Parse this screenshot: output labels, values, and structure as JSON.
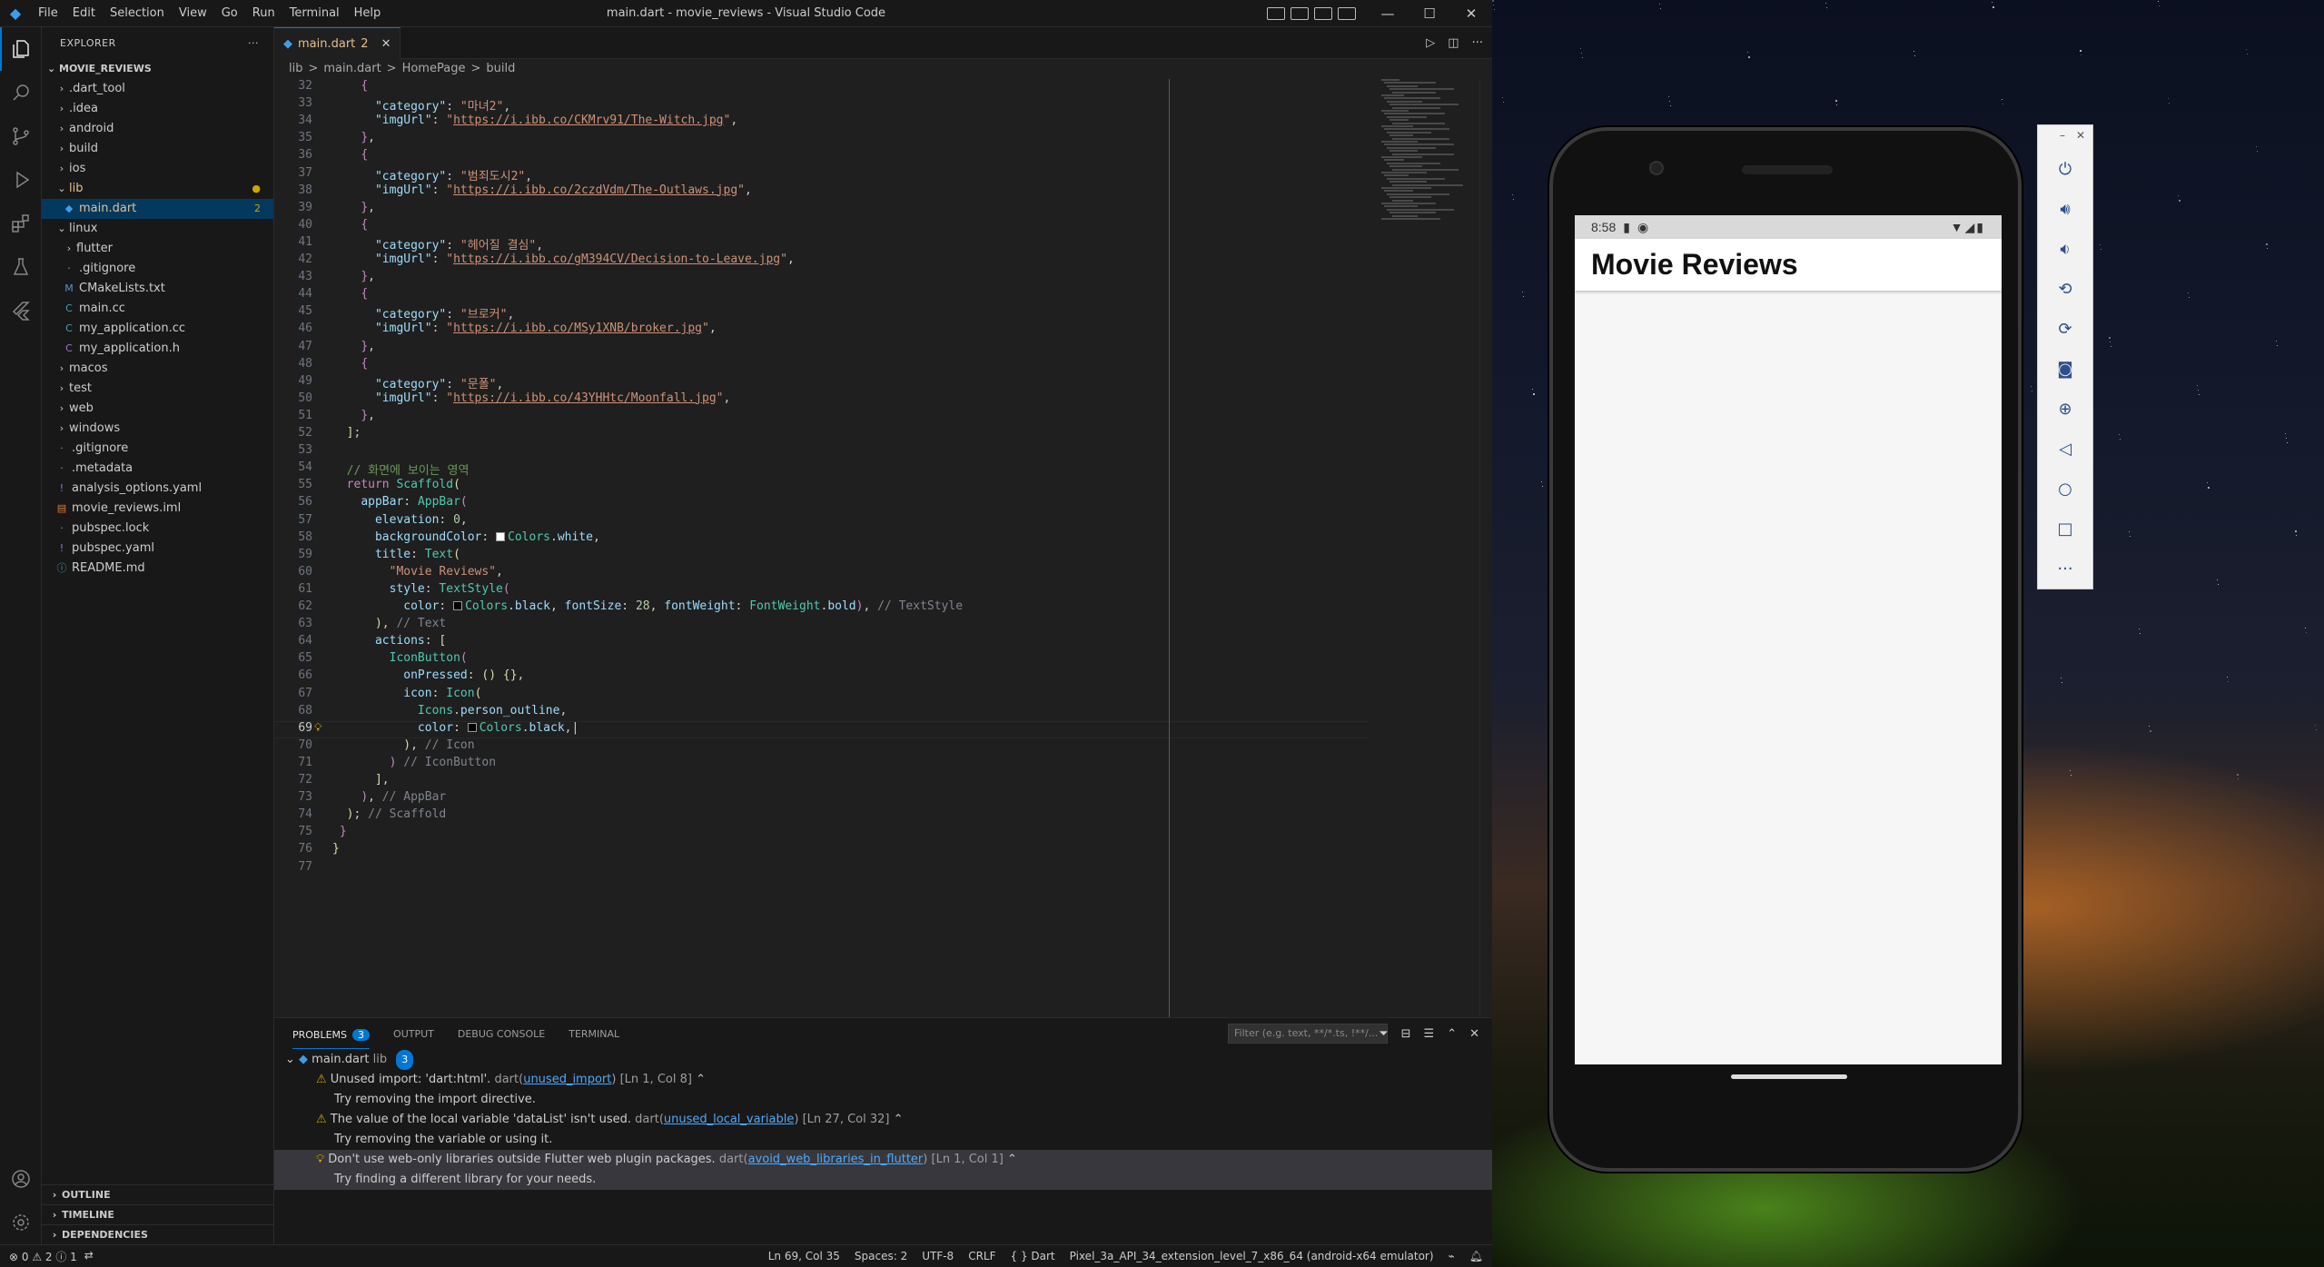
{
  "window": {
    "title": "main.dart - movie_reviews - Visual Studio Code",
    "menu": [
      "File",
      "Edit",
      "Selection",
      "View",
      "Go",
      "Run",
      "Terminal",
      "Help"
    ]
  },
  "explorer": {
    "header": "EXPLORER",
    "root": "MOVIE_REVIEWS",
    "items": [
      {
        "label": ".dart_tool",
        "kind": "folder",
        "depth": 0
      },
      {
        "label": ".idea",
        "kind": "folder",
        "depth": 0
      },
      {
        "label": "android",
        "kind": "folder",
        "depth": 0
      },
      {
        "label": "build",
        "kind": "folder",
        "depth": 0
      },
      {
        "label": "ios",
        "kind": "folder",
        "depth": 0
      },
      {
        "label": "lib",
        "kind": "folder-open",
        "depth": 0,
        "modified": true
      },
      {
        "label": "main.dart",
        "kind": "dart",
        "depth": 1,
        "selected": true,
        "badge": "2"
      },
      {
        "label": "linux",
        "kind": "folder-open",
        "depth": 0
      },
      {
        "label": "flutter",
        "kind": "folder",
        "depth": 1
      },
      {
        "label": ".gitignore",
        "kind": "file",
        "depth": 1
      },
      {
        "label": "CMakeLists.txt",
        "kind": "cmake",
        "depth": 1
      },
      {
        "label": "main.cc",
        "kind": "cpp",
        "depth": 1
      },
      {
        "label": "my_application.cc",
        "kind": "cpp",
        "depth": 1
      },
      {
        "label": "my_application.h",
        "kind": "c",
        "depth": 1
      },
      {
        "label": "macos",
        "kind": "folder",
        "depth": 0
      },
      {
        "label": "test",
        "kind": "folder",
        "depth": 0
      },
      {
        "label": "web",
        "kind": "folder",
        "depth": 0
      },
      {
        "label": "windows",
        "kind": "folder",
        "depth": 0
      },
      {
        "label": ".gitignore",
        "kind": "file",
        "depth": 0
      },
      {
        "label": ".metadata",
        "kind": "file",
        "depth": 0
      },
      {
        "label": "analysis_options.yaml",
        "kind": "yaml",
        "depth": 0
      },
      {
        "label": "movie_reviews.iml",
        "kind": "iml",
        "depth": 0
      },
      {
        "label": "pubspec.lock",
        "kind": "file",
        "depth": 0
      },
      {
        "label": "pubspec.yaml",
        "kind": "yaml",
        "depth": 0
      },
      {
        "label": "README.md",
        "kind": "info",
        "depth": 0
      }
    ],
    "sections": [
      "OUTLINE",
      "TIMELINE",
      "DEPENDENCIES"
    ]
  },
  "editor": {
    "tab": {
      "label": "main.dart",
      "badge": "2"
    },
    "breadcrumb": [
      "lib",
      ">",
      "main.dart",
      ">",
      "HomePage",
      ">",
      "build"
    ],
    "current_line": "69",
    "lines": [
      {
        "n": "32",
        "html": "    <span class='k'>{</span>"
      },
      {
        "n": "33",
        "html": "      <span class='p'>\"category\"</span>: <span class='s'>\"마녀2\"</span>,"
      },
      {
        "n": "34",
        "html": "      <span class='p'>\"imgUrl\"</span>: <span class='s'>\"</span><span class='u'>https://i.ibb.co/CKMrv91/The-Witch.jpg</span><span class='s'>\"</span>,"
      },
      {
        "n": "35",
        "html": "    <span class='k'>}</span>,"
      },
      {
        "n": "36",
        "html": "    <span class='k'>{</span>"
      },
      {
        "n": "37",
        "html": "      <span class='p'>\"category\"</span>: <span class='s'>\"범죄도시2\"</span>,"
      },
      {
        "n": "38",
        "html": "      <span class='p'>\"imgUrl\"</span>: <span class='s'>\"</span><span class='u'>https://i.ibb.co/2czdVdm/The-Outlaws.jpg</span><span class='s'>\"</span>,"
      },
      {
        "n": "39",
        "html": "    <span class='k'>}</span>,"
      },
      {
        "n": "40",
        "html": "    <span class='k'>{</span>"
      },
      {
        "n": "41",
        "html": "      <span class='p'>\"category\"</span>: <span class='s'>\"헤어질 결심\"</span>,"
      },
      {
        "n": "42",
        "html": "      <span class='p'>\"imgUrl\"</span>: <span class='s'>\"</span><span class='u'>https://i.ibb.co/gM394CV/Decision-to-Leave.jpg</span><span class='s'>\"</span>,"
      },
      {
        "n": "43",
        "html": "    <span class='k'>}</span>,"
      },
      {
        "n": "44",
        "html": "    <span class='k'>{</span>"
      },
      {
        "n": "45",
        "html": "      <span class='p'>\"category\"</span>: <span class='s'>\"브로커\"</span>,"
      },
      {
        "n": "46",
        "html": "      <span class='p'>\"imgUrl\"</span>: <span class='s'>\"</span><span class='u'>https://i.ibb.co/MSy1XNB/broker.jpg</span><span class='s'>\"</span>,"
      },
      {
        "n": "47",
        "html": "    <span class='k'>}</span>,"
      },
      {
        "n": "48",
        "html": "    <span class='k'>{</span>"
      },
      {
        "n": "49",
        "html": "      <span class='p'>\"category\"</span>: <span class='s'>\"문폴\"</span>,"
      },
      {
        "n": "50",
        "html": "      <span class='p'>\"imgUrl\"</span>: <span class='s'>\"</span><span class='u'>https://i.ibb.co/43YHHtc/Moonfall.jpg</span><span class='s'>\"</span>,"
      },
      {
        "n": "51",
        "html": "    <span class='k'>}</span>,"
      },
      {
        "n": "52",
        "html": "  <span class='f'>]</span>;"
      },
      {
        "n": "53",
        "html": ""
      },
      {
        "n": "54",
        "html": "  <span class='c'>// 화면에 보이는 영역</span>"
      },
      {
        "n": "55",
        "html": "  <span class='k'>return</span> <span class='cl'>Scaffold</span><span class='f'>(</span>"
      },
      {
        "n": "56",
        "html": "    <span class='p'>appBar</span>: <span class='cl'>AppBar</span><span class='k'>(</span>"
      },
      {
        "n": "57",
        "html": "      <span class='p'>elevation</span>: <span class='n'>0</span>,"
      },
      {
        "n": "58",
        "html": "      <span class='p'>backgroundColor</span>: <span class='sw' style='background:#fff'></span><span class='cl'>Colors</span>.<span class='p'>white</span>,"
      },
      {
        "n": "59",
        "html": "      <span class='p'>title</span>: <span class='cl'>Text</span><span class='f'>(</span>"
      },
      {
        "n": "60",
        "html": "        <span class='s'>\"Movie Reviews\"</span>,"
      },
      {
        "n": "61",
        "html": "        <span class='p'>style</span>: <span class='cl'>TextStyle</span><span class='k'>(</span>"
      },
      {
        "n": "62",
        "html": "          <span class='p'>color</span>: <span class='sw' style='background:#000'></span><span class='cl'>Colors</span>.<span class='p'>black</span>, <span class='p'>fontSize</span>: <span class='n'>28</span>, <span class='p'>fontWeight</span>: <span class='cl'>FontWeight</span>.<span class='p'>bold</span><span class='k'>)</span>, <span class='g'>// TextStyle</span>"
      },
      {
        "n": "63",
        "html": "      <span class='f'>)</span>, <span class='g'>// Text</span>"
      },
      {
        "n": "64",
        "html": "      <span class='p'>actions</span>: <span class='f'>[</span>"
      },
      {
        "n": "65",
        "html": "        <span class='cl'>IconButton</span><span class='k'>(</span>"
      },
      {
        "n": "66",
        "html": "          <span class='p'>onPressed</span>: <span class='f'>() {}</span>,"
      },
      {
        "n": "67",
        "html": "          <span class='p'>icon</span>: <span class='cl'>Icon</span><span class='f'>(</span>"
      },
      {
        "n": "68",
        "html": "            <span class='cl'>Icons</span>.<span class='p'>person_outline</span>,"
      },
      {
        "n": "69",
        "html": "            <span class='p'>color</span>: <span class='sw' style='background:#000'></span><span class='cl'>Colors</span>.<span class='p'>black</span>,|"
      },
      {
        "n": "70",
        "html": "          <span class='f'>)</span>, <span class='g'>// Icon</span>"
      },
      {
        "n": "71",
        "html": "        <span class='k'>)</span> <span class='g'>// IconButton</span>"
      },
      {
        "n": "72",
        "html": "      <span class='f'>]</span>,"
      },
      {
        "n": "73",
        "html": "    <span class='k'>)</span>, <span class='g'>// AppBar</span>"
      },
      {
        "n": "74",
        "html": "  <span class='f'>)</span>; <span class='g'>// Scaffold</span>"
      },
      {
        "n": "75",
        "html": " <span class='k'>}</span>"
      },
      {
        "n": "76",
        "html": "<span class='f'>}</span>"
      },
      {
        "n": "77",
        "html": ""
      }
    ]
  },
  "panel": {
    "tabs": [
      "PROBLEMS",
      "OUTPUT",
      "DEBUG CONSOLE",
      "TERMINAL"
    ],
    "problems_count": "3",
    "filter_placeholder": "Filter (e.g. text, **/*.ts, !**/...",
    "file": {
      "name": "main.dart",
      "dir": "lib",
      "count": "3"
    },
    "problems": [
      {
        "icon": "warning",
        "msg": "Unused import: 'dart:html'.",
        "src": "dart",
        "code": "unused_import",
        "loc": "[Ln 1, Col 8]",
        "hint": "Try removing the import directive."
      },
      {
        "icon": "warning",
        "msg": "The value of the local variable 'dataList' isn't used.",
        "src": "dart",
        "code": "unused_local_variable",
        "loc": "[Ln 27, Col 32]",
        "hint": "Try removing the variable or using it."
      },
      {
        "icon": "info",
        "msg": "Don't use web-only libraries outside Flutter web plugin packages.",
        "src": "dart",
        "code": "avoid_web_libraries_in_flutter",
        "loc": "[Ln 1, Col 1]",
        "hint": "Try finding a different library for your needs."
      }
    ]
  },
  "statusbar": {
    "left": "⊗ 0 ⚠ 2 ⓘ 1",
    "position": "Ln 69, Col 35",
    "spaces": "Spaces: 2",
    "encoding": "UTF-8",
    "eol": "CRLF",
    "lang": "{ } Dart",
    "device": "Pixel_3a_API_34_extension_level_7_x86_64 (android-x64 emulator)"
  },
  "phone": {
    "time": "8:58",
    "appbar_title": "Movie Reviews"
  },
  "colors": {
    "accent": "#0078d4",
    "editor_bg": "#1f1f1f",
    "sidebar_bg": "#181818"
  }
}
